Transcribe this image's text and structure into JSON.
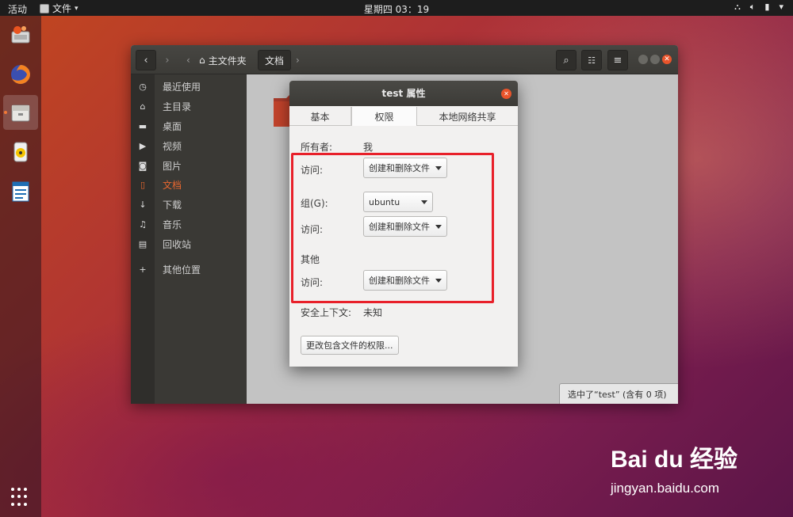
{
  "topbar": {
    "activities": "活动",
    "app_menu": "文件",
    "clock": "星期四 03：19"
  },
  "dock": {
    "items": [
      {
        "name": "installer"
      },
      {
        "name": "firefox"
      },
      {
        "name": "files"
      },
      {
        "name": "rhythmbox"
      },
      {
        "name": "writer"
      }
    ]
  },
  "file_manager": {
    "breadcrumb": {
      "home": "主文件夹",
      "current": "文档"
    },
    "sidebar": {
      "items": [
        {
          "label": "最近使用",
          "icon": "clock"
        },
        {
          "label": "主目录",
          "icon": "home"
        },
        {
          "label": "桌面",
          "icon": "folder"
        },
        {
          "label": "视频",
          "icon": "video"
        },
        {
          "label": "图片",
          "icon": "camera"
        },
        {
          "label": "文档",
          "icon": "document"
        },
        {
          "label": "下载",
          "icon": "download"
        },
        {
          "label": "音乐",
          "icon": "music"
        },
        {
          "label": "回收站",
          "icon": "trash"
        },
        {
          "label": "其他位置",
          "icon": "plus"
        }
      ]
    },
    "status": "选中了“test” (含有 0 项)"
  },
  "dialog": {
    "title": "test 属性",
    "tabs": [
      "基本",
      "权限",
      "本地网络共享"
    ],
    "owner_label": "所有者:",
    "owner_value": "我",
    "access_label": "访问:",
    "owner_access": "创建和删除文件",
    "group_label": "组(G):",
    "group_value": "ubuntu",
    "group_access": "创建和删除文件",
    "others_label": "其他",
    "others_access": "创建和删除文件",
    "security_label": "安全上下文:",
    "security_value": "未知",
    "change_button": "更改包含文件的权限..."
  },
  "watermark": {
    "logo": "Bai du 经验",
    "url": "jingyan.baidu.com"
  },
  "colors": {
    "accent": "#e9672f",
    "highlight": "#e8202a",
    "close": "#e9542b"
  }
}
